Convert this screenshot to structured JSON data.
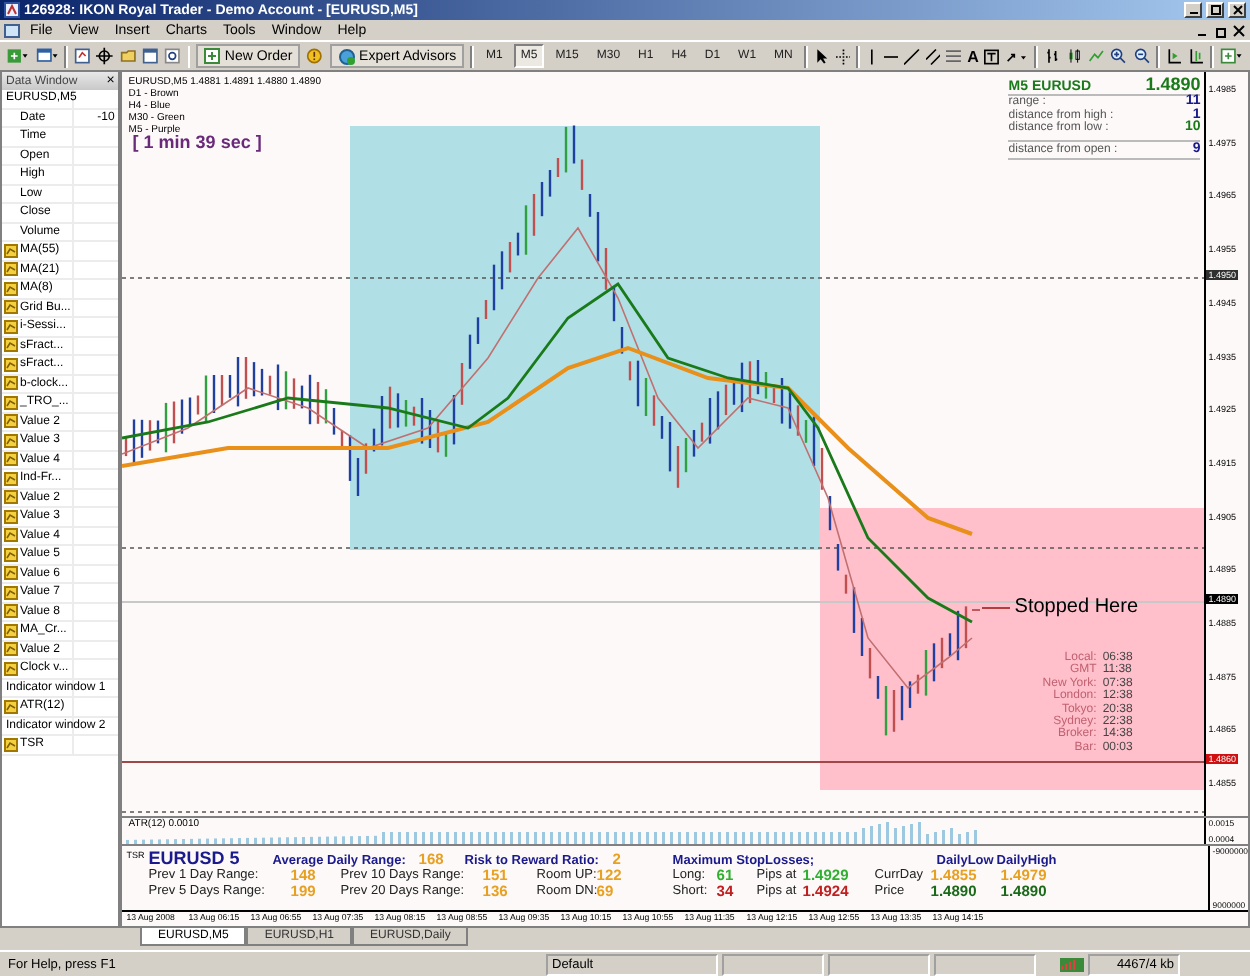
{
  "window": {
    "title": "126928: IKON Royal Trader - Demo Account - [EURUSD,M5]"
  },
  "menu": [
    "File",
    "View",
    "Insert",
    "Charts",
    "Tools",
    "Window",
    "Help"
  ],
  "toolbar": {
    "new_order": "New Order",
    "expert_advisors": "Expert Advisors",
    "text_tool": "A",
    "timeframes": [
      {
        "label": "M1",
        "selected": false
      },
      {
        "label": "M5",
        "selected": true
      },
      {
        "label": "M15",
        "selected": false
      },
      {
        "label": "M30",
        "selected": false
      },
      {
        "label": "H1",
        "selected": false
      },
      {
        "label": "H4",
        "selected": false
      },
      {
        "label": "D1",
        "selected": false
      },
      {
        "label": "W1",
        "selected": false
      },
      {
        "label": "MN",
        "selected": false
      }
    ]
  },
  "data_window": {
    "title": "Data Window",
    "close": "×",
    "rows": [
      {
        "kind": "group",
        "label": "EURUSD,M5"
      },
      {
        "kind": "field",
        "label": "Date",
        "value": "-10"
      },
      {
        "kind": "field",
        "label": "Time"
      },
      {
        "kind": "field",
        "label": "Open"
      },
      {
        "kind": "field",
        "label": "High"
      },
      {
        "kind": "field",
        "label": "Low"
      },
      {
        "kind": "field",
        "label": "Close"
      },
      {
        "kind": "field",
        "label": "Volume"
      },
      {
        "kind": "indicator",
        "label": "MA(55)"
      },
      {
        "kind": "indicator",
        "label": "MA(21)"
      },
      {
        "kind": "indicator",
        "label": "MA(8)"
      },
      {
        "kind": "indicator",
        "label": "Grid Bu..."
      },
      {
        "kind": "indicator",
        "label": "i-Sessi..."
      },
      {
        "kind": "indicator",
        "label": "sFract..."
      },
      {
        "kind": "indicator",
        "label": "sFract..."
      },
      {
        "kind": "indicator",
        "label": "b-clock..."
      },
      {
        "kind": "indicator",
        "label": "_TRO_..."
      },
      {
        "kind": "indicator",
        "label": "Value 2"
      },
      {
        "kind": "indicator",
        "label": "Value 3"
      },
      {
        "kind": "indicator",
        "label": "Value 4"
      },
      {
        "kind": "indicator",
        "label": "Ind-Fr..."
      },
      {
        "kind": "indicator",
        "label": "Value 2"
      },
      {
        "kind": "indicator",
        "label": "Value 3"
      },
      {
        "kind": "indicator",
        "label": "Value 4"
      },
      {
        "kind": "indicator",
        "label": "Value 5"
      },
      {
        "kind": "indicator",
        "label": "Value 6"
      },
      {
        "kind": "indicator",
        "label": "Value 7"
      },
      {
        "kind": "indicator",
        "label": "Value 8"
      },
      {
        "kind": "indicator",
        "label": "MA_Cr..."
      },
      {
        "kind": "indicator",
        "label": "Value 2"
      },
      {
        "kind": "indicator",
        "label": "Clock v..."
      },
      {
        "kind": "group",
        "label": "Indicator window 1"
      },
      {
        "kind": "indicator",
        "label": "ATR(12)"
      },
      {
        "kind": "group",
        "label": "Indicator window 2"
      },
      {
        "kind": "indicator",
        "label": "TSR"
      }
    ]
  },
  "chart": {
    "legend_header": "EURUSD,M5  1.4881 1.4891 1.4880 1.4890",
    "legend": [
      "D1 - Brown",
      "H4 - Blue",
      "M30 - Green",
      "M5 - Purple"
    ],
    "timer": "[ 1 min 39 sec ]",
    "info": {
      "title": "M5 EURUSD",
      "price": "1.4890",
      "rows": [
        {
          "label": "range :",
          "value": "11",
          "color": "#1a1a8c"
        },
        {
          "label": "distance from high :",
          "value": "1",
          "color": "#1a1a8c"
        },
        {
          "label": "distance from low :",
          "value": "10",
          "color": "#1a7a1a"
        },
        {
          "label": "distance from open :",
          "value": "9",
          "color": "#1a1a8c"
        }
      ]
    },
    "note": "Stopped Here",
    "clock": [
      {
        "label": "Local:",
        "time": "06:38"
      },
      {
        "label": "GMT",
        "time": "11:38"
      },
      {
        "label": "New York:",
        "time": "07:38"
      },
      {
        "label": "London:",
        "time": "12:38"
      },
      {
        "label": "Tokyo:",
        "time": "20:38"
      },
      {
        "label": "Sydney:",
        "time": "22:38"
      },
      {
        "label": "Broker:",
        "time": "14:38"
      },
      {
        "label": "Bar:",
        "time": "00:03"
      }
    ],
    "price_axis": [
      "1.4985",
      "1.4975",
      "1.4965",
      "1.4955",
      "1.4945",
      "1.4935",
      "1.4925",
      "1.4915",
      "1.4905",
      "1.4895",
      "1.4885",
      "1.4875",
      "1.4865",
      "1.4855"
    ],
    "price_marks": [
      {
        "kind": "level",
        "label": "1.4950"
      },
      {
        "kind": "current",
        "label": "1.4890"
      },
      {
        "kind": "alert",
        "label": "1.4860"
      }
    ]
  },
  "atr": {
    "label": "ATR(12) 0.0010",
    "axis": [
      "0.0015",
      "0.0004"
    ]
  },
  "tsr": {
    "label": "TSR",
    "axis": [
      "-9000000",
      "9000000"
    ],
    "header": [
      {
        "text": "EURUSD 5",
        "kind": "title"
      },
      {
        "text": "Average Daily Range:",
        "kind": "head"
      },
      {
        "text": "168",
        "kind": "value"
      },
      {
        "text": "Risk to Reward Ratio:",
        "kind": "head"
      },
      {
        "text": "2",
        "kind": "value"
      },
      {
        "text": "Maximum StopLosses;",
        "kind": "head"
      },
      {
        "text": "DailyLow",
        "kind": "head"
      },
      {
        "text": "DailyHigh",
        "kind": "head"
      }
    ],
    "rows": [
      [
        {
          "text": "Prev 1 Day Range:",
          "kind": "label"
        },
        {
          "text": "148",
          "kind": "value"
        },
        {
          "text": "Prev 10 Days Range:",
          "kind": "label"
        },
        {
          "text": "151",
          "kind": "value"
        },
        {
          "text": "Room UP:",
          "kind": "label"
        },
        {
          "text": "122",
          "kind": "value"
        },
        {
          "text": "Long:",
          "kind": "label"
        },
        {
          "text": "61",
          "kind": "good"
        },
        {
          "text": "Pips at",
          "kind": "label"
        },
        {
          "text": "1.4929",
          "kind": "good"
        },
        {
          "text": "CurrDay",
          "kind": "label"
        },
        {
          "text": "1.4855",
          "kind": "value"
        },
        {
          "text": "1.4979",
          "kind": "value"
        }
      ],
      [
        {
          "text": "Prev 5 Days Range:",
          "kind": "label"
        },
        {
          "text": "199",
          "kind": "value"
        },
        {
          "text": "Prev 20 Days Range:",
          "kind": "label"
        },
        {
          "text": "136",
          "kind": "value"
        },
        {
          "text": "Room DN:",
          "kind": "label"
        },
        {
          "text": "69",
          "kind": "value"
        },
        {
          "text": "Short:",
          "kind": "label"
        },
        {
          "text": "34",
          "kind": "bad"
        },
        {
          "text": "Pips at",
          "kind": "label"
        },
        {
          "text": "1.4924",
          "kind": "bad"
        },
        {
          "text": "Price",
          "kind": "label"
        },
        {
          "text": "1.4890",
          "kind": "price"
        },
        {
          "text": "1.4890",
          "kind": "price"
        }
      ]
    ]
  },
  "time_axis": [
    "13 Aug 2008",
    "13 Aug 06:15",
    "13 Aug 06:55",
    "13 Aug 07:35",
    "13 Aug 08:15",
    "13 Aug 08:55",
    "13 Aug 09:35",
    "13 Aug 10:15",
    "13 Aug 10:55",
    "13 Aug 11:35",
    "13 Aug 12:15",
    "13 Aug 12:55",
    "13 Aug 13:35",
    "13 Aug 14:15"
  ],
  "chart_tabs": [
    {
      "label": "EURUSD,M5",
      "selected": true
    },
    {
      "label": "EURUSD,H1",
      "selected": false
    },
    {
      "label": "EURUSD,Daily",
      "selected": false
    }
  ],
  "status_bar": {
    "help": "For Help, press F1",
    "profile": "Default",
    "traffic": "4467/4 kb"
  }
}
